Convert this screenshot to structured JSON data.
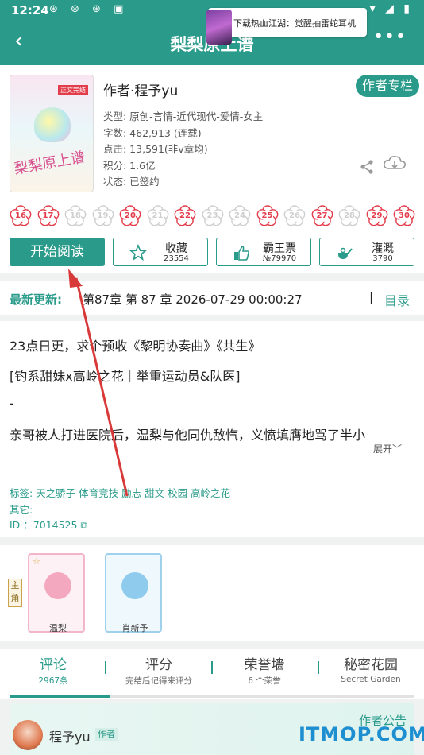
{
  "status_bar": {
    "time": "12:24",
    "left_icons": "⊛ ⊛ ⊛ ▣",
    "right_icons": "▾ ◢ ▮"
  },
  "header": {
    "back_icon": "‹",
    "title": "梨梨原上谱",
    "more_icon": "•••"
  },
  "ad": {
    "text": "下载热血江湖：觉醒抽雷蛇耳机"
  },
  "book": {
    "cover_tag": "正文完结",
    "cover_title": "梨梨原上谱",
    "author": "作者·程予yu",
    "author_column_label": "作者专栏",
    "type": "类型: 原创-言情-近代现代-爱情-女主",
    "word_count": "字数: 462,913 (连载)",
    "clicks": "点击: 13,591(非v章均)",
    "points": "积分: 1.6亿",
    "status": "状态: 已签约"
  },
  "flowers": [
    {
      "num": "16",
      "on": true
    },
    {
      "num": "17",
      "on": true
    },
    {
      "num": "18",
      "on": false
    },
    {
      "num": "19",
      "on": false
    },
    {
      "num": "20",
      "on": true
    },
    {
      "num": "21",
      "on": false
    },
    {
      "num": "22",
      "on": true
    },
    {
      "num": "23",
      "on": false
    },
    {
      "num": "24",
      "on": false
    },
    {
      "num": "25",
      "on": true
    },
    {
      "num": "26",
      "on": false
    },
    {
      "num": "27",
      "on": true
    },
    {
      "num": "28",
      "on": false
    },
    {
      "num": "29",
      "on": true
    },
    {
      "num": "30",
      "on": true
    }
  ],
  "actions": {
    "read": "开始阅读",
    "favorite": {
      "label": "收藏",
      "count": "23554"
    },
    "overlord": {
      "label": "霸王票",
      "count": "№79970"
    },
    "water": {
      "label": "灌溉",
      "count": "3790"
    }
  },
  "latest": {
    "label": "最新更新:",
    "text": "第87章  第 87 章  2026-07-29 00:00:27",
    "separator": "|",
    "toc": "目录"
  },
  "description": {
    "line1": "23点日更，求个预收《黎明协奏曲》《共生》",
    "line2": "[钓系甜妹x高岭之花｜举重运动员&队医]",
    "line3": "-",
    "line4": "亲哥被人打进医院后，温梨与他同仇敌忾，义愤填膺地骂了半小",
    "expand": "展开﹀",
    "tags": "标签:  天之骄子 体育竞技 励志 甜文 校园 高岭之花",
    "other": "其它:",
    "id": "ID   ：7014525 ⧉"
  },
  "characters": {
    "role_tag": "主角",
    "crown": "☆",
    "list": [
      {
        "name": "温梨"
      },
      {
        "name": "肖新予"
      }
    ]
  },
  "tabs": [
    {
      "label": "评论",
      "sub": "2967条",
      "active": true
    },
    {
      "label": "评分",
      "sub": "完结后记得来评分",
      "active": false
    },
    {
      "label": "荣誉墙",
      "sub": "6 个荣誉",
      "active": false
    },
    {
      "label": "秘密花园",
      "sub": "Secret Garden",
      "active": false
    }
  ],
  "comment": {
    "name": "程予yu",
    "badge": "作者",
    "notice": "作者公告"
  },
  "watermark": "ITMOP.COM",
  "colors": {
    "primary": "#2a9b8a",
    "flower_on": "#e33c4a",
    "flower_off": "#cfcfcf",
    "arrow": "#d83a3a"
  }
}
